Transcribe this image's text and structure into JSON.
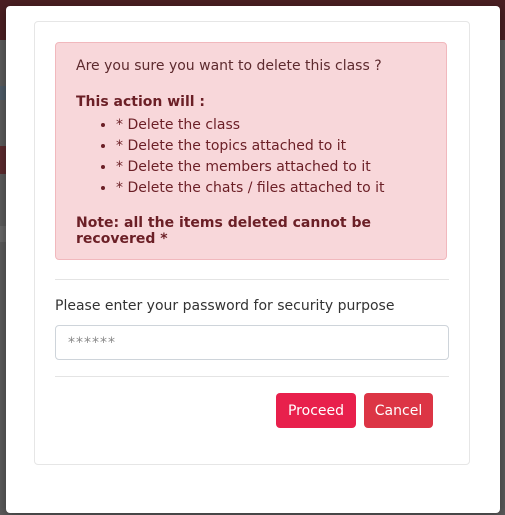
{
  "dialog": {
    "question": "Are you sure you want to delete this class ?",
    "action_title": "This action will :",
    "actions": [
      "* Delete the class",
      "* Delete the topics attached to it",
      "* Delete the members attached to it",
      "* Delete the chats / files attached to it"
    ],
    "note": "Note: all the items deleted cannot be recovered *"
  },
  "password": {
    "label": "Please enter your password for security purpose",
    "placeholder": "******"
  },
  "buttons": {
    "proceed": "Proceed",
    "cancel": "Cancel"
  },
  "colors": {
    "alert_bg": "#f8d7da",
    "alert_text": "#6b1f26",
    "proceed": "#e8204c",
    "cancel": "#dc3545"
  }
}
